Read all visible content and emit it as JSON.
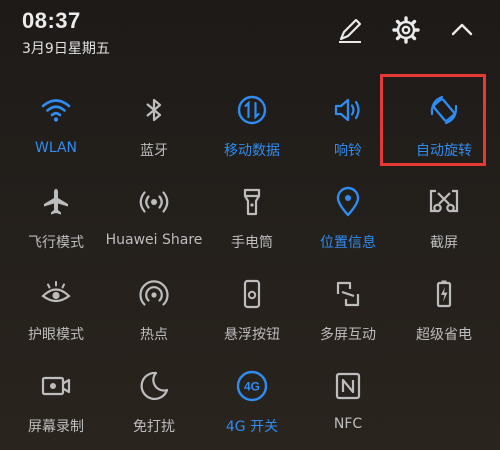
{
  "status": {
    "time": "08:37",
    "date": "3月9日星期五"
  },
  "colors": {
    "active": "#2f8cf0",
    "inactive": "#bdbdbd",
    "highlight": "#e53935"
  },
  "header": {
    "icons": [
      "edit-pencil-icon",
      "gear-icon",
      "chevron-up-icon"
    ]
  },
  "tiles": [
    {
      "label": "WLAN",
      "icon": "wifi-icon",
      "active": true
    },
    {
      "label": "蓝牙",
      "icon": "bluetooth-icon",
      "active": false
    },
    {
      "label": "移动数据",
      "icon": "mobile-data-icon",
      "active": true
    },
    {
      "label": "响铃",
      "icon": "speaker-icon",
      "active": true
    },
    {
      "label": "自动旋转",
      "icon": "auto-rotate-icon",
      "active": true
    },
    {
      "label": "飞行模式",
      "icon": "airplane-icon",
      "active": false
    },
    {
      "label": "Huawei Share",
      "icon": "share-wave-icon",
      "active": false
    },
    {
      "label": "手电筒",
      "icon": "flashlight-icon",
      "active": false
    },
    {
      "label": "位置信息",
      "icon": "location-pin-icon",
      "active": true
    },
    {
      "label": "截屏",
      "icon": "screenshot-scissors-icon",
      "active": false
    },
    {
      "label": "护眼模式",
      "icon": "eye-icon",
      "active": false
    },
    {
      "label": "热点",
      "icon": "hotspot-icon",
      "active": false
    },
    {
      "label": "悬浮按钮",
      "icon": "floating-button-icon",
      "active": false
    },
    {
      "label": "多屏互动",
      "icon": "multi-screen-icon",
      "active": false
    },
    {
      "label": "超级省电",
      "icon": "battery-saver-icon",
      "active": false
    },
    {
      "label": "屏幕录制",
      "icon": "screen-record-icon",
      "active": false
    },
    {
      "label": "免打扰",
      "icon": "moon-icon",
      "active": false
    },
    {
      "label": "4G 开关",
      "icon": "4g-icon",
      "active": true,
      "icon_text": "4G"
    },
    {
      "label": "NFC",
      "icon": "nfc-icon",
      "active": false
    }
  ]
}
